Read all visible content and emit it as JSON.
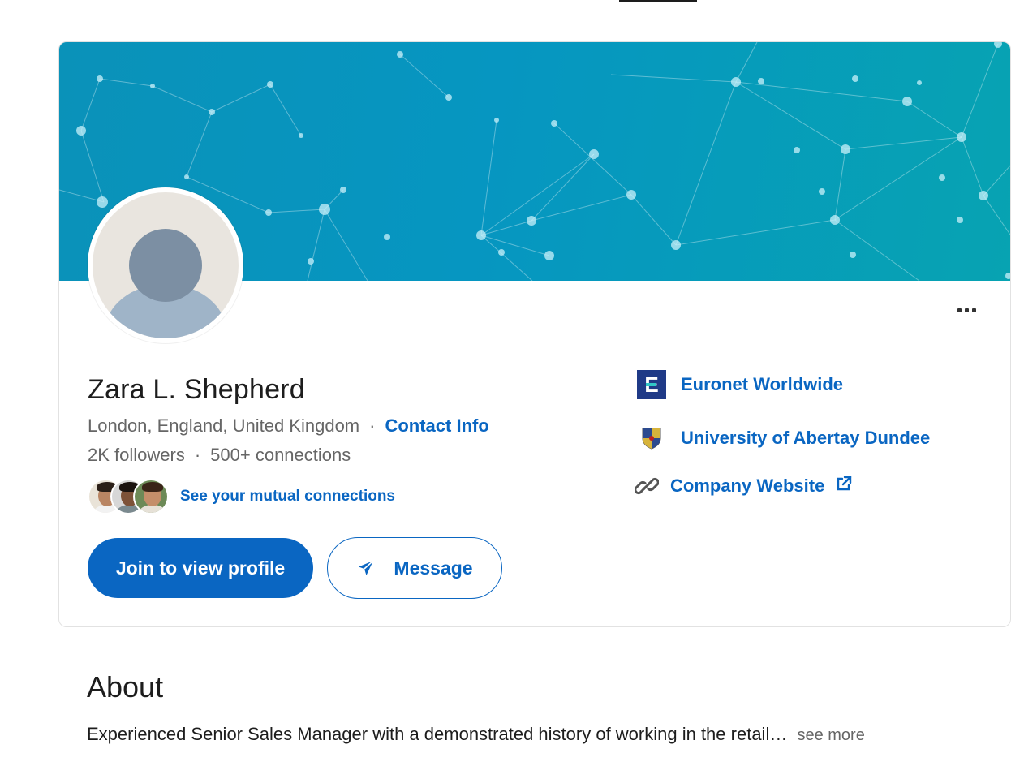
{
  "profile": {
    "name": "Zara L. Shepherd",
    "location": "London, England, United Kingdom",
    "contact_info_label": "Contact Info",
    "followers": "2K followers",
    "connections": "500+ connections",
    "mutual_connections_label": "See your mutual connections"
  },
  "actions": {
    "join_label": "Join to view profile",
    "message_label": "Message"
  },
  "right_links": {
    "company": "Euronet Worldwide",
    "company_logo_letter": "Ε",
    "school": "University of Abertay Dundee",
    "website": "Company Website"
  },
  "about": {
    "title": "About",
    "text": "Experienced Senior Sales Manager with a demonstrated history of working in the retail…",
    "see_more": "see more"
  },
  "icons": {
    "more": "more-horizontal-icon",
    "send": "send-icon",
    "link": "link-icon",
    "external": "external-link-icon"
  },
  "colors": {
    "accent": "#0a66c2",
    "banner_start": "#0a92b9",
    "banner_end": "#07a3b2",
    "text_muted": "#666666"
  }
}
